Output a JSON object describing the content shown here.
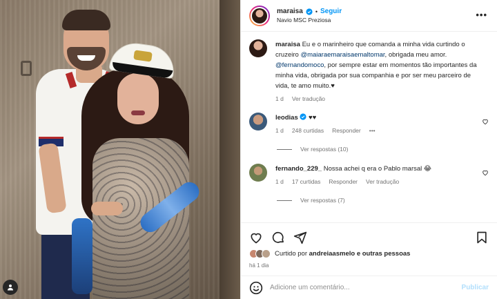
{
  "post": {
    "username": "maraisa",
    "follow_label": "Seguir",
    "separator": "•",
    "location": "Navio MSC Preziosa"
  },
  "caption": {
    "username": "maraisa",
    "text_1": "Eu e o marinheiro que comanda a minha vida curtindo o cruzeiro ",
    "mention_1": "@maiaraemaraisaemaltomar",
    "text_2": ", obrigada meu amor. ",
    "mention_2": "@fernandomoco",
    "text_3": ", por sempre estar em momentos tão importantes da minha vida, obrigada por sua companhia e por ser meu parceiro de vida, te amo muito.♥",
    "time": "1 d",
    "translate": "Ver tradução"
  },
  "comments": [
    {
      "username": "leodias",
      "text": "♥♥",
      "time": "1 d",
      "likes": "248 curtidas",
      "reply": "Responder",
      "more": "•••",
      "replies": "Ver respostas (10)"
    },
    {
      "username": "fernando_229_",
      "text": "Nossa achei q era o Pablo marsal 😂",
      "time": "1 d",
      "likes": "17 curtidas",
      "reply": "Responder",
      "translate": "Ver tradução",
      "replies": "Ver respostas (7)"
    }
  ],
  "likes": {
    "prefix": "Curtido por ",
    "user": "andreiaasmelo",
    "suffix": " e outras pessoas"
  },
  "timestamp": "há 1 dia",
  "add_comment": {
    "placeholder": "Adicione um comentário...",
    "publish": "Publicar"
  },
  "colors": {
    "accent": "#0095f6",
    "link": "#00376b",
    "muted": "#737373"
  }
}
